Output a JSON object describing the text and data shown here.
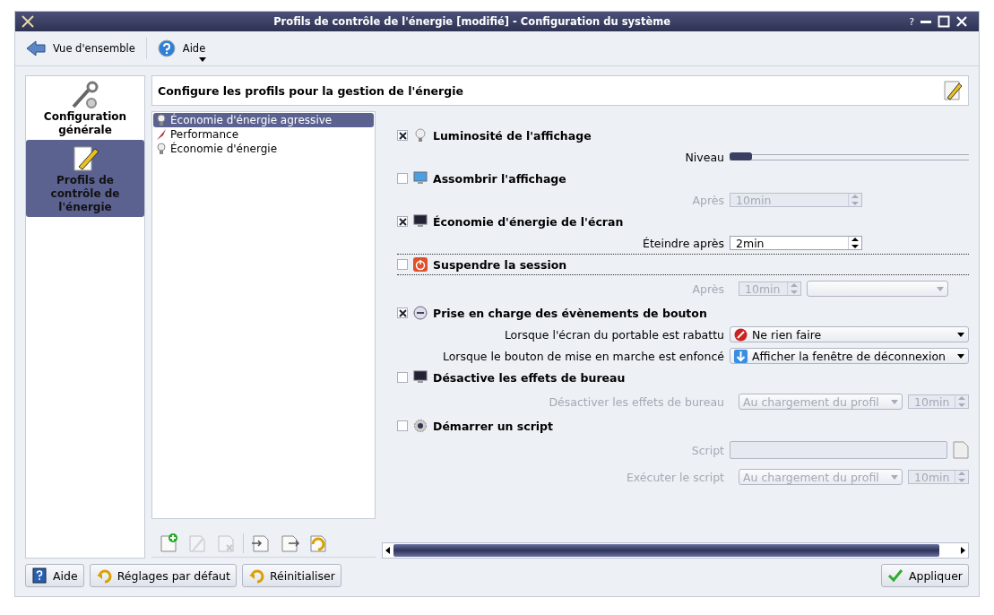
{
  "window": {
    "title": "Profils de contrôle de l'énergie [modifié] - Configuration du système",
    "help_glyph": "?"
  },
  "toolbar": [
    {
      "kind": "back",
      "label": "Vue d'ensemble"
    },
    {
      "kind": "help",
      "label": "Aide"
    }
  ],
  "sidebar": {
    "items": [
      {
        "label": "Configuration générale",
        "selected": false
      },
      {
        "label": "Profils de contrôle de l'énergie",
        "selected": true
      }
    ]
  },
  "header": {
    "title": "Configure les profils pour la gestion de l'énergie"
  },
  "profiles": [
    {
      "label": "Économie d'énergie agressive",
      "selected": true
    },
    {
      "label": "Performance",
      "selected": false
    },
    {
      "label": "Économie d'énergie",
      "selected": false
    }
  ],
  "profile_toolbar": [
    {
      "kind": "new",
      "disabled": false
    },
    {
      "kind": "edit",
      "disabled": true
    },
    {
      "kind": "delete",
      "disabled": true
    },
    {
      "kind": "import",
      "disabled": false
    },
    {
      "kind": "export",
      "disabled": false
    },
    {
      "kind": "undo",
      "disabled": false
    }
  ],
  "groups": [
    {
      "title": "Luminosité de l'affichage",
      "checked": true,
      "focused": false,
      "rows": [
        {
          "kind": "slider",
          "label": "Niveau",
          "level": 0,
          "disabled": false
        }
      ]
    },
    {
      "title": "Assombrir l'affichage",
      "checked": false,
      "focused": false,
      "rows": [
        {
          "kind": "spin",
          "label": "Après",
          "value": "10min",
          "disabled": true
        }
      ]
    },
    {
      "title": "Économie d'énergie de l'écran",
      "checked": true,
      "focused": false,
      "rows": [
        {
          "kind": "spin",
          "label": "Éteindre après",
          "value": "2min",
          "disabled": false
        }
      ]
    },
    {
      "title": "Suspendre la session",
      "checked": false,
      "focused": true,
      "rows": [
        {
          "kind": "spin-combo",
          "label": "Après",
          "value": "10min",
          "disabled": true
        }
      ]
    },
    {
      "title": "Prise en charge des évènements de bouton",
      "checked": true,
      "focused": false,
      "rows": [
        {
          "kind": "combo",
          "label": "Lorsque l'écran du portable est rabattu",
          "value": "Ne rien faire",
          "disabled": false
        },
        {
          "kind": "combo",
          "label": "Lorsque le bouton de mise en marche est enfoncé",
          "value": "Afficher la fenêtre de déconnexion",
          "disabled": false
        }
      ]
    },
    {
      "title": "Désactive les effets de bureau",
      "checked": false,
      "focused": false,
      "rows": [
        {
          "kind": "combo-spin",
          "label": "Désactiver les effets de bureau",
          "value": "Au chargement du profil",
          "value2": "10min",
          "disabled": true
        }
      ]
    },
    {
      "title": "Démarrer un script",
      "checked": false,
      "focused": false,
      "rows": [
        {
          "kind": "file",
          "label": "Script",
          "disabled": true
        },
        {
          "kind": "combo-spin",
          "label": "Exécuter le script",
          "value": "Au chargement du profil",
          "value2": "10min",
          "disabled": true
        }
      ]
    }
  ],
  "buttons": [
    {
      "kind": "help",
      "label": "Aide"
    },
    {
      "kind": "defaults",
      "label": "Réglages par défaut"
    },
    {
      "kind": "reset",
      "label": "Réinitialiser"
    },
    {
      "kind": "apply",
      "label": "Appliquer"
    }
  ]
}
